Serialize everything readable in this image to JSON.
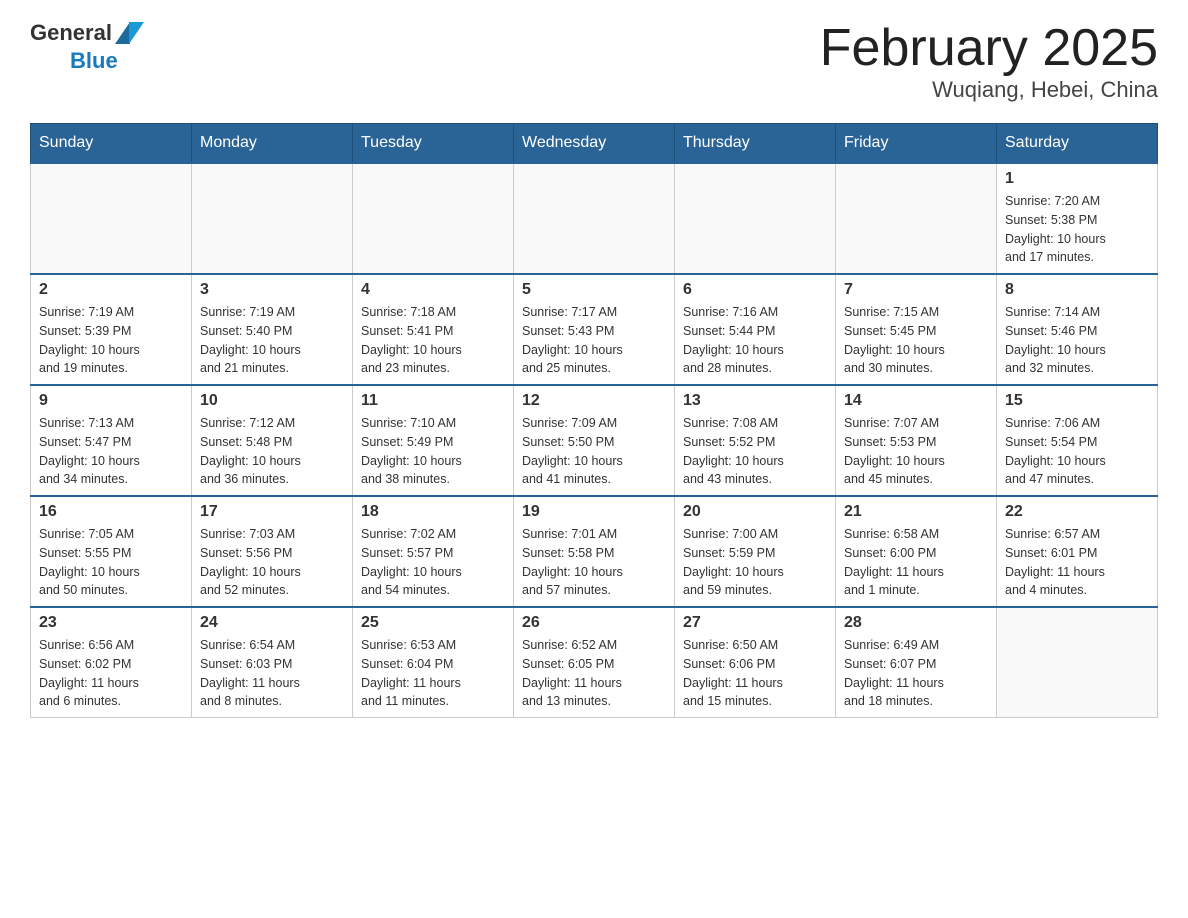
{
  "header": {
    "logo_general": "General",
    "logo_blue": "Blue",
    "title": "February 2025",
    "location": "Wuqiang, Hebei, China"
  },
  "weekdays": [
    "Sunday",
    "Monday",
    "Tuesday",
    "Wednesday",
    "Thursday",
    "Friday",
    "Saturday"
  ],
  "weeks": [
    [
      {
        "day": "",
        "info": ""
      },
      {
        "day": "",
        "info": ""
      },
      {
        "day": "",
        "info": ""
      },
      {
        "day": "",
        "info": ""
      },
      {
        "day": "",
        "info": ""
      },
      {
        "day": "",
        "info": ""
      },
      {
        "day": "1",
        "info": "Sunrise: 7:20 AM\nSunset: 5:38 PM\nDaylight: 10 hours\nand 17 minutes."
      }
    ],
    [
      {
        "day": "2",
        "info": "Sunrise: 7:19 AM\nSunset: 5:39 PM\nDaylight: 10 hours\nand 19 minutes."
      },
      {
        "day": "3",
        "info": "Sunrise: 7:19 AM\nSunset: 5:40 PM\nDaylight: 10 hours\nand 21 minutes."
      },
      {
        "day": "4",
        "info": "Sunrise: 7:18 AM\nSunset: 5:41 PM\nDaylight: 10 hours\nand 23 minutes."
      },
      {
        "day": "5",
        "info": "Sunrise: 7:17 AM\nSunset: 5:43 PM\nDaylight: 10 hours\nand 25 minutes."
      },
      {
        "day": "6",
        "info": "Sunrise: 7:16 AM\nSunset: 5:44 PM\nDaylight: 10 hours\nand 28 minutes."
      },
      {
        "day": "7",
        "info": "Sunrise: 7:15 AM\nSunset: 5:45 PM\nDaylight: 10 hours\nand 30 minutes."
      },
      {
        "day": "8",
        "info": "Sunrise: 7:14 AM\nSunset: 5:46 PM\nDaylight: 10 hours\nand 32 minutes."
      }
    ],
    [
      {
        "day": "9",
        "info": "Sunrise: 7:13 AM\nSunset: 5:47 PM\nDaylight: 10 hours\nand 34 minutes."
      },
      {
        "day": "10",
        "info": "Sunrise: 7:12 AM\nSunset: 5:48 PM\nDaylight: 10 hours\nand 36 minutes."
      },
      {
        "day": "11",
        "info": "Sunrise: 7:10 AM\nSunset: 5:49 PM\nDaylight: 10 hours\nand 38 minutes."
      },
      {
        "day": "12",
        "info": "Sunrise: 7:09 AM\nSunset: 5:50 PM\nDaylight: 10 hours\nand 41 minutes."
      },
      {
        "day": "13",
        "info": "Sunrise: 7:08 AM\nSunset: 5:52 PM\nDaylight: 10 hours\nand 43 minutes."
      },
      {
        "day": "14",
        "info": "Sunrise: 7:07 AM\nSunset: 5:53 PM\nDaylight: 10 hours\nand 45 minutes."
      },
      {
        "day": "15",
        "info": "Sunrise: 7:06 AM\nSunset: 5:54 PM\nDaylight: 10 hours\nand 47 minutes."
      }
    ],
    [
      {
        "day": "16",
        "info": "Sunrise: 7:05 AM\nSunset: 5:55 PM\nDaylight: 10 hours\nand 50 minutes."
      },
      {
        "day": "17",
        "info": "Sunrise: 7:03 AM\nSunset: 5:56 PM\nDaylight: 10 hours\nand 52 minutes."
      },
      {
        "day": "18",
        "info": "Sunrise: 7:02 AM\nSunset: 5:57 PM\nDaylight: 10 hours\nand 54 minutes."
      },
      {
        "day": "19",
        "info": "Sunrise: 7:01 AM\nSunset: 5:58 PM\nDaylight: 10 hours\nand 57 minutes."
      },
      {
        "day": "20",
        "info": "Sunrise: 7:00 AM\nSunset: 5:59 PM\nDaylight: 10 hours\nand 59 minutes."
      },
      {
        "day": "21",
        "info": "Sunrise: 6:58 AM\nSunset: 6:00 PM\nDaylight: 11 hours\nand 1 minute."
      },
      {
        "day": "22",
        "info": "Sunrise: 6:57 AM\nSunset: 6:01 PM\nDaylight: 11 hours\nand 4 minutes."
      }
    ],
    [
      {
        "day": "23",
        "info": "Sunrise: 6:56 AM\nSunset: 6:02 PM\nDaylight: 11 hours\nand 6 minutes."
      },
      {
        "day": "24",
        "info": "Sunrise: 6:54 AM\nSunset: 6:03 PM\nDaylight: 11 hours\nand 8 minutes."
      },
      {
        "day": "25",
        "info": "Sunrise: 6:53 AM\nSunset: 6:04 PM\nDaylight: 11 hours\nand 11 minutes."
      },
      {
        "day": "26",
        "info": "Sunrise: 6:52 AM\nSunset: 6:05 PM\nDaylight: 11 hours\nand 13 minutes."
      },
      {
        "day": "27",
        "info": "Sunrise: 6:50 AM\nSunset: 6:06 PM\nDaylight: 11 hours\nand 15 minutes."
      },
      {
        "day": "28",
        "info": "Sunrise: 6:49 AM\nSunset: 6:07 PM\nDaylight: 11 hours\nand 18 minutes."
      },
      {
        "day": "",
        "info": ""
      }
    ]
  ]
}
